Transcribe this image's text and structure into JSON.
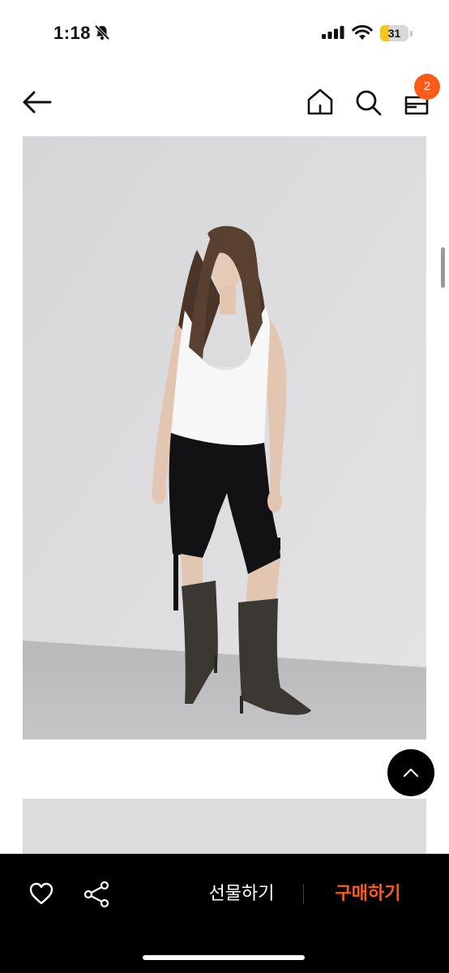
{
  "status_bar": {
    "time": "1:18",
    "battery_level": "31",
    "battery_fraction": 0.31,
    "icons": [
      "bell-muted-icon",
      "signal-icon",
      "wifi-icon",
      "battery-icon"
    ]
  },
  "nav": {
    "back_icon": "arrow-left-icon",
    "home_icon": "home-icon",
    "search_icon": "search-icon",
    "bag_icon": "shopping-bag-icon",
    "bag_count": "2"
  },
  "product": {
    "images": [
      "model-photo-white-tank-black-shorts-boots",
      "product-photo-2"
    ]
  },
  "scroll_top_icon": "chevron-up-icon",
  "bottom_bar": {
    "heart_icon": "heart-icon",
    "share_icon": "share-icon",
    "gift_label": "선물하기",
    "buy_label": "구매하기"
  },
  "colors": {
    "accent": "#ff5a1a",
    "bottom_bar_bg": "#000000",
    "battery_yellow": "#f5c518"
  }
}
